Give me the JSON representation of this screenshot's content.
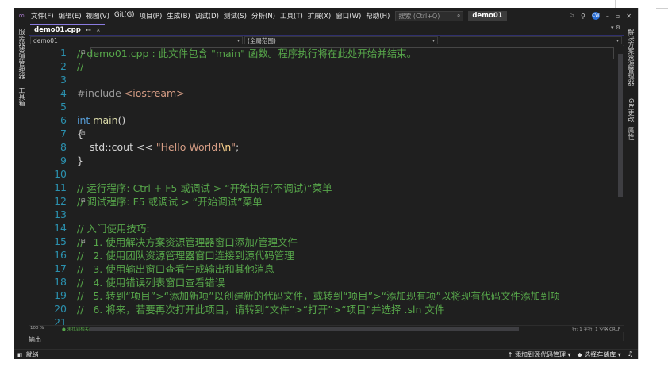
{
  "menu": {
    "items": [
      "文件(F)",
      "编辑(E)",
      "视图(V)",
      "Git(G)",
      "项目(P)",
      "生成(B)",
      "调试(D)",
      "测试(S)",
      "分析(N)",
      "工具(T)",
      "扩展(X)",
      "窗口(W)",
      "帮助(H)"
    ],
    "search_placeholder": "搜索 (Ctrl+Q)",
    "solution_title": "demo01",
    "avatar_initials": "CW"
  },
  "left_tabs": [
    "服务器资源管理器",
    "工具箱"
  ],
  "right_tabs": [
    "解决方案资源管理器",
    "Git 更改",
    "属性"
  ],
  "tab": {
    "label": "demo01.cpp",
    "pin": "⊷",
    "close": "×"
  },
  "navbar": {
    "project": "demo01",
    "scope": "(全局范围)"
  },
  "code_lines": [
    {
      "n": "1",
      "parts": [
        {
          "c": "cmt",
          "t": "// demo01.cpp : 此文件包含 \"main\" 函数。程序执行将在此处开始并结束。"
        }
      ]
    },
    {
      "n": "2",
      "parts": [
        {
          "c": "cmt",
          "t": "//"
        }
      ]
    },
    {
      "n": "3",
      "parts": []
    },
    {
      "n": "4",
      "parts": [
        {
          "c": "dir",
          "t": "#include "
        },
        {
          "c": "inc",
          "t": "<iostream>"
        }
      ]
    },
    {
      "n": "5",
      "parts": []
    },
    {
      "n": "6",
      "parts": [
        {
          "c": "kw",
          "t": "int "
        },
        {
          "c": "fn",
          "t": "main"
        },
        {
          "c": "plain",
          "t": "()"
        }
      ]
    },
    {
      "n": "7",
      "parts": [
        {
          "c": "plain",
          "t": "{"
        }
      ]
    },
    {
      "n": "8",
      "parts": [
        {
          "c": "plain",
          "t": "    std::cout << "
        },
        {
          "c": "str",
          "t": "\"Hello World!"
        },
        {
          "c": "esc",
          "t": "\\n"
        },
        {
          "c": "str",
          "t": "\""
        },
        {
          "c": "plain",
          "t": ";"
        }
      ]
    },
    {
      "n": "9",
      "parts": [
        {
          "c": "plain",
          "t": "}"
        }
      ]
    },
    {
      "n": "10",
      "parts": []
    },
    {
      "n": "11",
      "parts": [
        {
          "c": "cmt",
          "t": "// 运行程序: Ctrl + F5 或调试 > “开始执行(不调试)”菜单"
        }
      ]
    },
    {
      "n": "12",
      "parts": [
        {
          "c": "cmt",
          "t": "// 调试程序: F5 或调试 > “开始调试”菜单"
        }
      ]
    },
    {
      "n": "13",
      "parts": []
    },
    {
      "n": "14",
      "parts": [
        {
          "c": "cmt",
          "t": "// 入门使用技巧:"
        }
      ]
    },
    {
      "n": "15",
      "parts": [
        {
          "c": "cmt",
          "t": "//   1. 使用解决方案资源管理器窗口添加/管理文件"
        }
      ]
    },
    {
      "n": "16",
      "parts": [
        {
          "c": "cmt",
          "t": "//   2. 使用团队资源管理器窗口连接到源代码管理"
        }
      ]
    },
    {
      "n": "17",
      "parts": [
        {
          "c": "cmt",
          "t": "//   3. 使用输出窗口查看生成输出和其他消息"
        }
      ]
    },
    {
      "n": "18",
      "parts": [
        {
          "c": "cmt",
          "t": "//   4. 使用错误列表窗口查看错误"
        }
      ]
    },
    {
      "n": "19",
      "parts": [
        {
          "c": "cmt",
          "t": "//   5. 转到“项目”>“添加新项”以创建新的代码文件，或转到“项目”>“添加现有项”以将现有代码文件添加到项"
        }
      ]
    },
    {
      "n": "20",
      "parts": [
        {
          "c": "cmt",
          "t": "//   6. 将来，若要再次打开此项目，请转到“文件”>“打开”>“项目”并选择 .sln 文件"
        }
      ]
    },
    {
      "n": "21",
      "parts": []
    }
  ],
  "hbar": {
    "zoom": "100 %",
    "issues": "未找到相关问题",
    "position": "行: 1    字符: 1    空格    CRLF"
  },
  "output_tab": "输出",
  "status": {
    "ready": "就绪",
    "add_source_control": "↑ 添加到源代码管理 ▾",
    "select_repo": "◆ 选择存储库 ▾",
    "bell": "♫"
  },
  "colors": {
    "background": "#1f1f1f",
    "comment": "#57a64a",
    "keyword": "#569cd6",
    "string": "#d69d85",
    "line_number": "#2b91af",
    "tab_accent": "#8a7be0"
  }
}
